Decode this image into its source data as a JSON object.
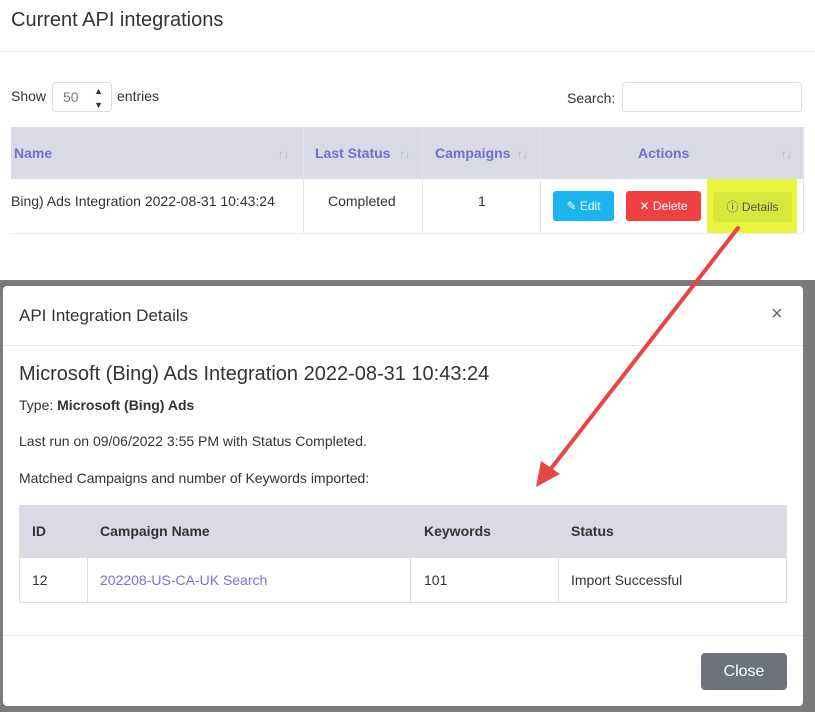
{
  "page": {
    "title": "Current API integrations",
    "show_label": "Show",
    "entries_value": "50",
    "entries_label": "entries",
    "search_label": "Search:",
    "search_value": ""
  },
  "table": {
    "columns": [
      {
        "label": "Name"
      },
      {
        "label": "Last Status"
      },
      {
        "label": "Campaigns"
      },
      {
        "label": "Actions"
      }
    ],
    "rows": [
      {
        "name": "Bing) Ads Integration 2022-08-31 10:43:24",
        "status": "Completed",
        "campaigns": "1",
        "actions": {
          "edit": "Edit",
          "delete": "Delete",
          "details": "Details"
        }
      }
    ]
  },
  "modal": {
    "title": "API Integration Details",
    "close_icon": "×",
    "integration_name": "Microsoft (Bing) Ads Integration 2022-08-31 10:43:24",
    "type_label": "Type:",
    "type_value": "Microsoft (Bing) Ads",
    "last_run": "Last run on 09/06/2022 3:55 PM with Status Completed.",
    "matched_label": "Matched Campaigns and number of Keywords imported:",
    "table": {
      "columns": [
        "ID",
        "Campaign Name",
        "Keywords",
        "Status"
      ],
      "rows": [
        {
          "id": "12",
          "campaign_name": "202208-US-CA-UK Search",
          "keywords": "101",
          "status": "Import Successful"
        }
      ]
    },
    "close_button": "Close"
  },
  "icons": {
    "sort": "sort-arrows-icon",
    "edit": "edit-icon",
    "delete": "x-icon",
    "details": "info-circle-icon",
    "close": "close-icon"
  },
  "colors": {
    "edit": "#1ab5ee",
    "delete": "#f04141",
    "highlight": "#e8f53c",
    "header_bg": "#d9dae6",
    "header_text": "#6f6fd3",
    "link": "#7d6ed8",
    "arrow": "#e84545"
  }
}
